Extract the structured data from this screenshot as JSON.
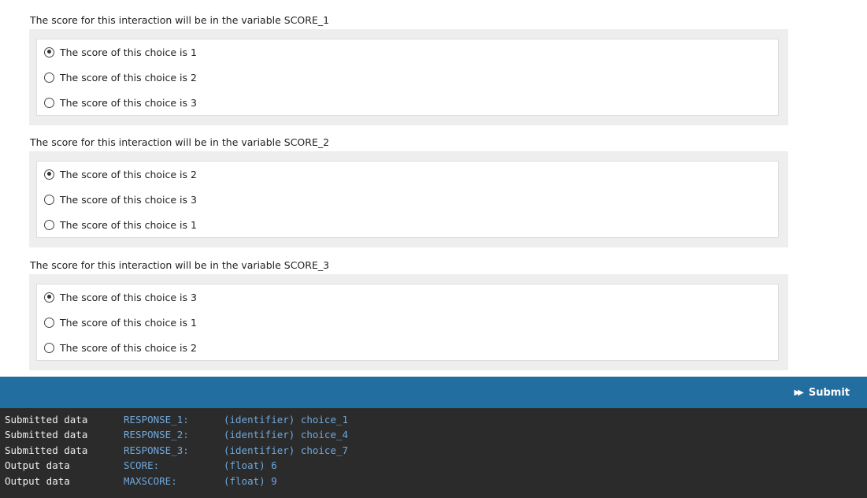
{
  "interactions": [
    {
      "prompt": "The score for this interaction will be in the variable SCORE_1",
      "choices": [
        {
          "label": "The score of this choice is 1",
          "checked": true
        },
        {
          "label": "The score of this choice is 2",
          "checked": false
        },
        {
          "label": "The score of this choice is 3",
          "checked": false
        }
      ]
    },
    {
      "prompt": "The score for this interaction will be in the variable SCORE_2",
      "choices": [
        {
          "label": "The score of this choice is 2",
          "checked": true
        },
        {
          "label": "The score of this choice is 3",
          "checked": false
        },
        {
          "label": "The score of this choice is 1",
          "checked": false
        }
      ]
    },
    {
      "prompt": "The score for this interaction will be in the variable SCORE_3",
      "choices": [
        {
          "label": "The score of this choice is 3",
          "checked": true
        },
        {
          "label": "The score of this choice is 1",
          "checked": false
        },
        {
          "label": "The score of this choice is 2",
          "checked": false
        }
      ]
    }
  ],
  "toolbar": {
    "submit_label": "Submit",
    "submit_icon": "fast-forward-icon",
    "background_color": "#236ea0"
  },
  "console": {
    "rows": [
      {
        "type": "Submitted data",
        "key": "RESPONSE_1:",
        "value": "(identifier) choice_1"
      },
      {
        "type": "Submitted data",
        "key": "RESPONSE_2:",
        "value": "(identifier) choice_4"
      },
      {
        "type": "Submitted data",
        "key": "RESPONSE_3:",
        "value": "(identifier) choice_7"
      },
      {
        "type": "Output data",
        "key": "SCORE:",
        "value": "(float) 6"
      },
      {
        "type": "Output data",
        "key": "MAXSCORE:",
        "value": "(float) 9"
      }
    ]
  }
}
